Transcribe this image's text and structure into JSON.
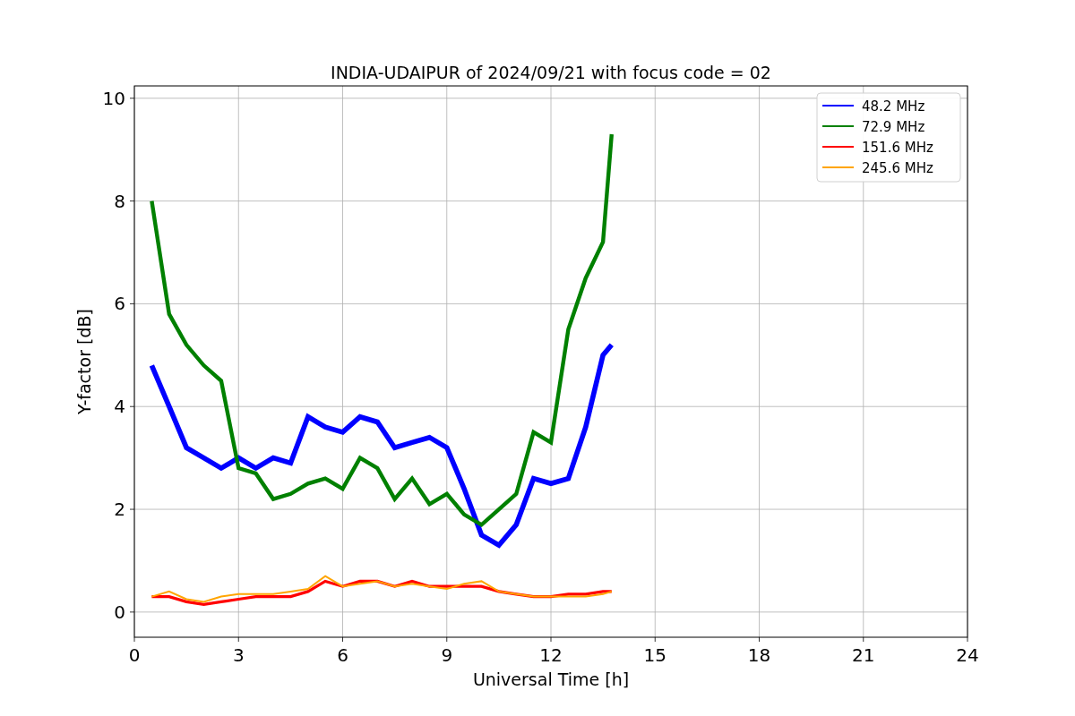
{
  "chart_data": {
    "type": "line",
    "title": "INDIA-UDAIPUR of 2024/09/21 with focus code = 02",
    "xlabel": "Universal Time [h]",
    "ylabel": "Y-factor [dB]",
    "x": [
      0.5,
      1,
      1.5,
      2,
      2.5,
      3,
      3.5,
      4,
      4.5,
      5,
      5.5,
      6,
      6.5,
      7,
      7.5,
      8,
      8.5,
      9,
      9.5,
      10,
      10.5,
      11,
      11.5,
      12,
      12.5,
      13,
      13.5,
      13.75
    ],
    "series": [
      {
        "name": "48.2 MHz",
        "color": "#0000ff",
        "values": [
          4.8,
          4.0,
          3.2,
          3.0,
          2.8,
          3.0,
          2.8,
          3.0,
          2.9,
          3.8,
          3.6,
          3.5,
          3.8,
          3.7,
          3.2,
          3.3,
          3.4,
          3.2,
          2.4,
          1.5,
          1.3,
          1.7,
          2.6,
          2.5,
          2.6,
          3.6,
          5.0,
          5.2
        ]
      },
      {
        "name": "72.9 MHz",
        "color": "#008000",
        "values": [
          8.0,
          5.8,
          5.2,
          4.8,
          4.5,
          2.8,
          2.7,
          2.2,
          2.3,
          2.5,
          2.6,
          2.4,
          3.0,
          2.8,
          2.2,
          2.6,
          2.1,
          2.3,
          1.9,
          1.7,
          2.0,
          2.3,
          3.5,
          3.3,
          5.5,
          6.5,
          7.2,
          9.3
        ]
      },
      {
        "name": "151.6 MHz",
        "color": "#ff0000",
        "values": [
          0.3,
          0.3,
          0.2,
          0.15,
          0.2,
          0.25,
          0.3,
          0.3,
          0.3,
          0.4,
          0.6,
          0.5,
          0.6,
          0.6,
          0.5,
          0.6,
          0.5,
          0.5,
          0.5,
          0.5,
          0.4,
          0.35,
          0.3,
          0.3,
          0.35,
          0.35,
          0.4,
          0.4
        ]
      },
      {
        "name": "245.6 MHz",
        "color": "#ffa500",
        "values": [
          0.3,
          0.4,
          0.25,
          0.2,
          0.3,
          0.35,
          0.35,
          0.35,
          0.4,
          0.45,
          0.7,
          0.5,
          0.55,
          0.6,
          0.5,
          0.55,
          0.5,
          0.45,
          0.55,
          0.6,
          0.4,
          0.35,
          0.3,
          0.3,
          0.3,
          0.3,
          0.35,
          0.4
        ]
      }
    ],
    "grid": true,
    "legend": true,
    "xlim": [
      0,
      24
    ],
    "ylim": [
      -0.49,
      10.24
    ],
    "xticks": [
      0,
      3,
      6,
      9,
      12,
      15,
      18,
      21,
      24
    ],
    "yticks": [
      0,
      2,
      4,
      6,
      8,
      10
    ]
  }
}
